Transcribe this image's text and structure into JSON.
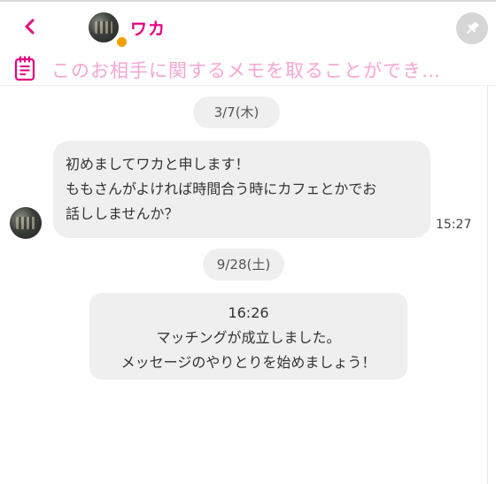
{
  "header": {
    "back_icon": "chevron-left-icon",
    "partner_name": "ワカ",
    "online_indicator_color": "#f0a000",
    "pin_icon": "pin-icon"
  },
  "memo": {
    "icon": "memo-icon",
    "placeholder": "このお相手に関するメモを取ることができ…"
  },
  "chat": {
    "dates": [
      "3/7(木)",
      "9/28(土)"
    ],
    "message": {
      "lines": [
        "初めましてワカと申します！",
        "ももさんがよければ時間合う時にカフェとかでお",
        "話ししませんか？"
      ],
      "time": "15:27"
    },
    "system": {
      "time": "16:26",
      "lines": [
        "マッチングが成立しました。",
        "メッセージのやりとりを始めましょう！"
      ]
    }
  },
  "colors": {
    "accent": "#e5007f",
    "memo_text": "#f7a6d2",
    "bubble_bg": "#efefef"
  }
}
